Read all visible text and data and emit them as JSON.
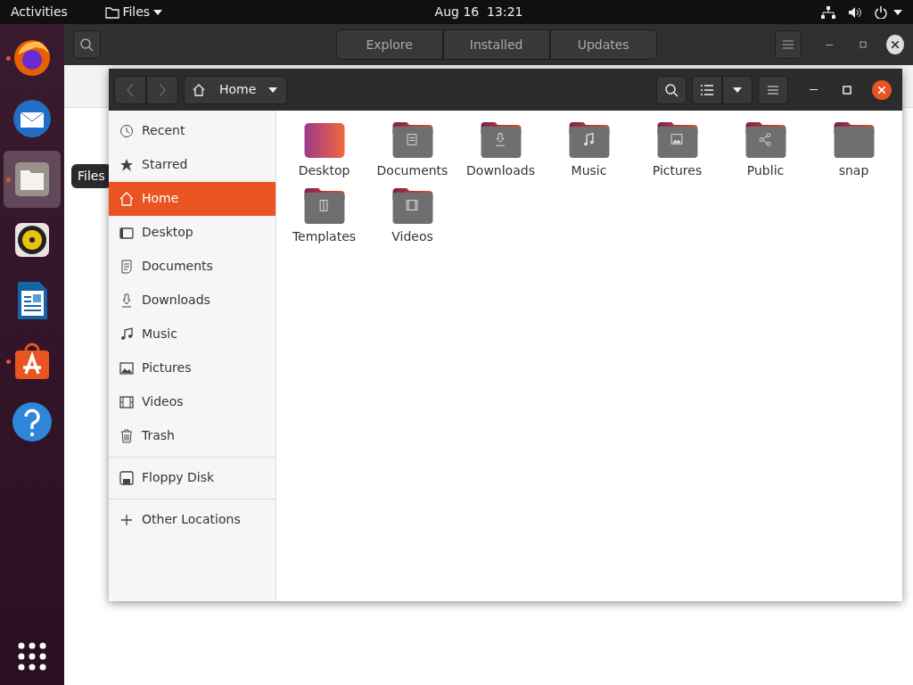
{
  "top_bar": {
    "activities": "Activities",
    "app_menu": "Files",
    "clock": "Aug 16  13:21"
  },
  "dock": {
    "items": [
      {
        "kind": "browser",
        "running": true,
        "selected": false
      },
      {
        "kind": "mail",
        "running": false,
        "selected": false
      },
      {
        "kind": "files",
        "running": true,
        "selected": true
      },
      {
        "kind": "music",
        "running": false,
        "selected": false
      },
      {
        "kind": "writer",
        "running": false,
        "selected": false
      },
      {
        "kind": "store",
        "running": true,
        "selected": false
      },
      {
        "kind": "help",
        "running": false,
        "selected": false
      }
    ],
    "tooltip": "Files"
  },
  "background_window": {
    "tabs": [
      {
        "label": "Explore",
        "selected": false
      },
      {
        "label": "Installed",
        "selected": false
      },
      {
        "label": "Updates",
        "selected": false
      }
    ]
  },
  "files_window": {
    "location": "Home",
    "sidebar": {
      "groups": [
        [
          {
            "label": "Recent",
            "kind": "recent",
            "selected": false
          },
          {
            "label": "Starred",
            "kind": "star",
            "selected": false
          },
          {
            "label": "Home",
            "kind": "home",
            "selected": true
          },
          {
            "label": "Desktop",
            "kind": "desktop",
            "selected": false
          },
          {
            "label": "Documents",
            "kind": "documents",
            "selected": false
          },
          {
            "label": "Downloads",
            "kind": "downloads",
            "selected": false
          },
          {
            "label": "Music",
            "kind": "music",
            "selected": false
          },
          {
            "label": "Pictures",
            "kind": "pictures",
            "selected": false
          },
          {
            "label": "Videos",
            "kind": "videos",
            "selected": false
          },
          {
            "label": "Trash",
            "kind": "trash",
            "selected": false
          }
        ],
        [
          {
            "label": "Floppy Disk",
            "kind": "floppy",
            "selected": false
          }
        ],
        [
          {
            "label": "Other Locations",
            "kind": "plus",
            "selected": false
          }
        ]
      ]
    },
    "items": [
      {
        "name": "Desktop",
        "kind": "desktop"
      },
      {
        "name": "Documents",
        "kind": "documents"
      },
      {
        "name": "Downloads",
        "kind": "downloads"
      },
      {
        "name": "Music",
        "kind": "music"
      },
      {
        "name": "Pictures",
        "kind": "pictures"
      },
      {
        "name": "Public",
        "kind": "public"
      },
      {
        "name": "snap",
        "kind": "plain"
      },
      {
        "name": "Templates",
        "kind": "templates"
      },
      {
        "name": "Videos",
        "kind": "videos"
      }
    ]
  }
}
